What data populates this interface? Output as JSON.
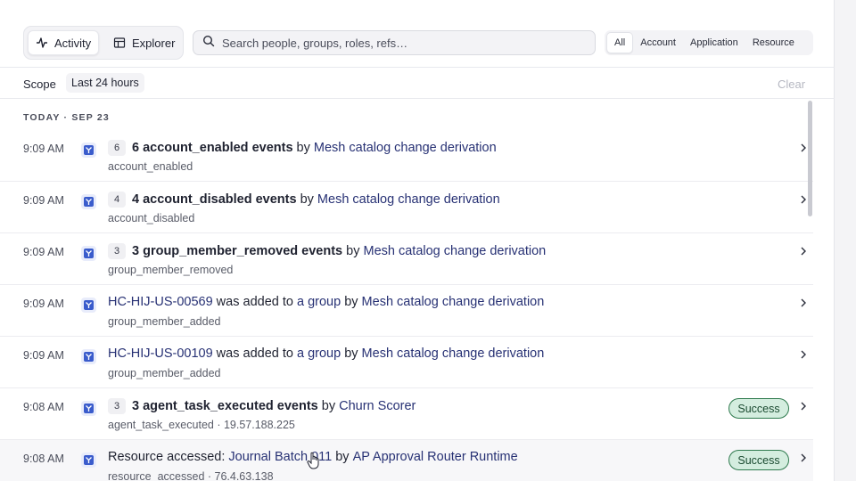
{
  "header": {
    "tabs": [
      {
        "label": "Activity",
        "icon": "activity-icon",
        "active": true
      },
      {
        "label": "Explorer",
        "icon": "table-icon",
        "active": false
      }
    ],
    "search": {
      "placeholder": "Search people, groups, roles, refs…",
      "value": ""
    },
    "filters": [
      {
        "label": "All",
        "active": true
      },
      {
        "label": "Account",
        "active": false
      },
      {
        "label": "Application",
        "active": false
      },
      {
        "label": "Resource",
        "active": false
      }
    ]
  },
  "scope": {
    "label": "Scope",
    "chip": "Last 24 hours",
    "clear_label": "Clear"
  },
  "feed": {
    "day_header": "TODAY · SEP 23",
    "rows": [
      {
        "time": "9:09 AM",
        "count": "6",
        "title_strong": "6 account_enabled events",
        "connector": " by ",
        "actor": "Mesh catalog change derivation",
        "sub": "account_enabled"
      },
      {
        "time": "9:09 AM",
        "count": "4",
        "title_strong": "4 account_disabled events",
        "connector": " by ",
        "actor": "Mesh catalog change derivation",
        "sub": "account_disabled"
      },
      {
        "time": "9:09 AM",
        "count": "3",
        "title_strong": "3 group_member_removed events",
        "connector": " by ",
        "actor": "Mesh catalog change derivation",
        "sub": "group_member_removed"
      },
      {
        "time": "9:09 AM",
        "subject": "HC-HIJ-US-00569",
        "middle": " was added to ",
        "object": "a group",
        "connector": " by ",
        "actor": "Mesh catalog change derivation",
        "sub": "group_member_added"
      },
      {
        "time": "9:09 AM",
        "subject": "HC-HIJ-US-00109",
        "middle": " was added to ",
        "object": "a group",
        "connector": " by ",
        "actor": "Mesh catalog change derivation",
        "sub": "group_member_added"
      },
      {
        "time": "9:08 AM",
        "count": "3",
        "title_strong": "3 agent_task_executed events",
        "connector": " by ",
        "actor": "Churn Scorer",
        "sub": "agent_task_executed · 19.57.188.225",
        "badge": "Success"
      },
      {
        "time": "9:08 AM",
        "prefix": "Resource accessed: ",
        "object": "Journal Batch 011",
        "connector": " by ",
        "actor": "AP Approval Router Runtime",
        "sub": "resource_accessed · 76.4.63.138",
        "badge": "Success"
      }
    ]
  },
  "colors": {
    "link": "#273174",
    "success_bg": "#d4eddf",
    "success_border": "#2f7a4e",
    "source_icon": "#3a5ccc"
  }
}
